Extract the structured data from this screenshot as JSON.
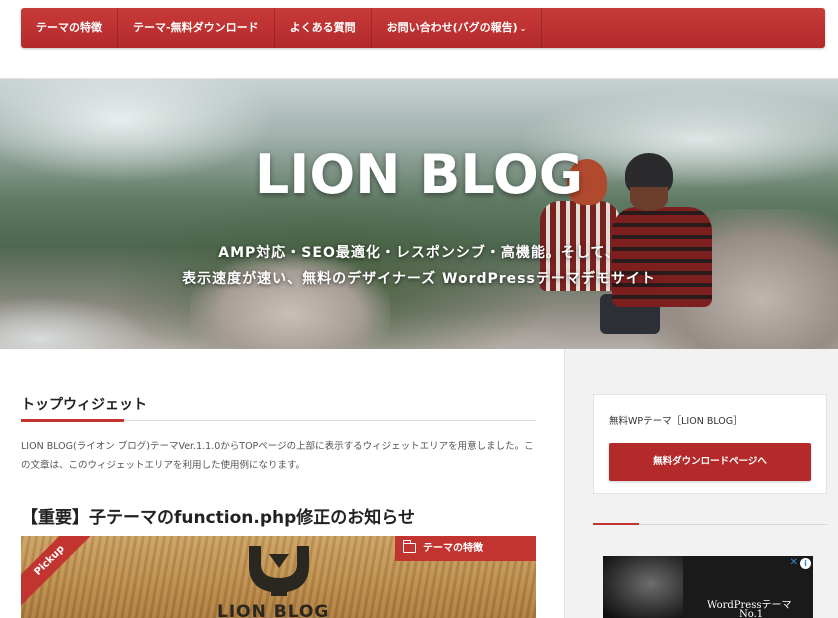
{
  "nav": {
    "items": [
      {
        "label": "テーマの特徴"
      },
      {
        "label": "テーマ-無料ダウンロード"
      },
      {
        "label": "よくある質問"
      },
      {
        "label": "お問い合わせ(バグの報告)",
        "has_dropdown": true
      }
    ]
  },
  "hero": {
    "title": "LION BLOG",
    "tagline_line1": "AMP対応・SEO最適化・レスポンシブ・高機能。そして、",
    "tagline_line2": "表示速度が速い、無料のデザイナーズ WordPressテーマデモサイト"
  },
  "main": {
    "widget": {
      "heading": "トップウィジェット",
      "text": "LION BLOG(ライオン ブログ)テーマVer.1.1.0からTOPページの上部に表示するウィジェットエリアを用意しました。この文章は、このウィジェットエリアを利用した使用例になります。"
    },
    "post": {
      "title": "【重要】子テーマのfunction.php修正のお知らせ",
      "pickup_label": "Pickup",
      "category": "テーマの特徴",
      "thumb_logo_text": "LION BLOG"
    }
  },
  "sidebar": {
    "promo": {
      "text": "無料WPテーマ［LION BLOG］",
      "button_label": "無料ダウンロードページへ"
    },
    "ad": {
      "line1": "WordPressテーマ",
      "line2": "No.1"
    }
  },
  "colors": {
    "accent": "#c2342f",
    "nav_bg": "#b42a2a"
  }
}
